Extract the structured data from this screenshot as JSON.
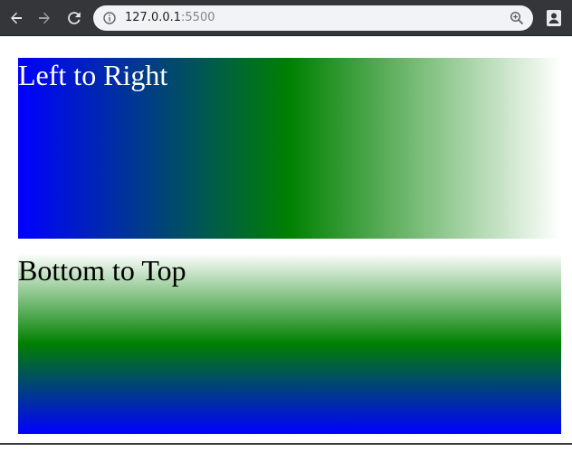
{
  "browser": {
    "url_host": "127.0.0.1",
    "url_port": ":5500",
    "icons": [
      "back-arrow-icon",
      "forward-arrow-icon",
      "reload-icon",
      "info-icon",
      "zoom-icon",
      "profile-icon"
    ],
    "colors": {
      "toolbar": "#35363a",
      "omnibox": "#f1f3f4"
    }
  },
  "page": {
    "boxes": [
      {
        "heading": "Left to Right",
        "gradient_colors": [
          "#0000ff",
          "#008000",
          "#ffffff"
        ],
        "direction": "to right"
      },
      {
        "heading": "Bottom to Top",
        "gradient_colors": [
          "#0000ff",
          "#008000",
          "#ffffff"
        ],
        "direction": "to top"
      }
    ]
  }
}
